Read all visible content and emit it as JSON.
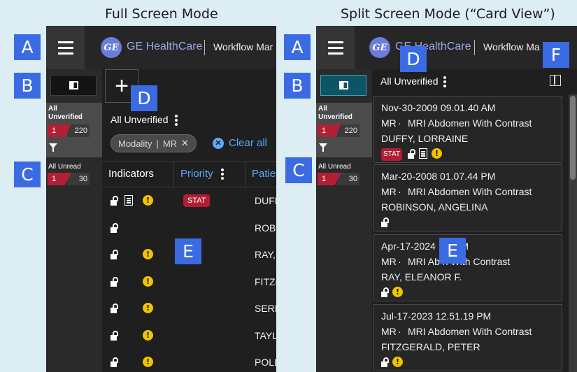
{
  "headings": {
    "full": "Full Screen Mode",
    "split": "Split Screen Mode (“Card View”)"
  },
  "markers": {
    "a": "A",
    "b": "B",
    "c": "C",
    "d": "D",
    "e": "E",
    "f": "F"
  },
  "app": {
    "brand": "GE HealthCare",
    "logo_text": "GE",
    "workflow_full": "Workflow Mar",
    "workflow_split": "Workflow Ma"
  },
  "sidebar": {
    "unverified_label_1": "All",
    "unverified_label_2": "Unverified",
    "unverified_red": "1",
    "unverified_total": "220",
    "unread_label": "All Unread",
    "unread_red": "1",
    "unread_total": "30"
  },
  "full": {
    "plus": "+",
    "list_title": "All Unverified",
    "chip_field": "Modality",
    "chip_sep": "|",
    "chip_value": "MR",
    "chip_close": "✕",
    "clear_all": "Clear all",
    "columns": [
      "Indicators",
      "Priority",
      "Patie"
    ],
    "rows": [
      {
        "patient": "DUFF",
        "stat": "STAT",
        "note": true,
        "warn": true
      },
      {
        "patient": "ROBI",
        "stat": "",
        "note": false,
        "warn": false
      },
      {
        "patient": "RAY,",
        "stat": "",
        "note": false,
        "warn": true
      },
      {
        "patient": "FITZ(",
        "stat": "",
        "note": false,
        "warn": true
      },
      {
        "patient": "SERR",
        "stat": "",
        "note": false,
        "warn": true
      },
      {
        "patient": "TAYL",
        "stat": "",
        "note": false,
        "warn": true
      },
      {
        "patient": "POLL",
        "stat": "",
        "note": false,
        "warn": true
      }
    ]
  },
  "split": {
    "list_title": "All Unverified",
    "cards": [
      {
        "datetime": "Nov-30-2009 09.01.40 AM",
        "modality": "MR",
        "desc": "MRI Abdomen With Contrast",
        "patient": "DUFFY, LORRAINE",
        "stat": "STAT",
        "note": true,
        "warn": true
      },
      {
        "datetime": "Mar-20-2008 01.07.44 PM",
        "modality": "MR",
        "desc": "MRI Abdomen With Contrast",
        "patient": "ROBINSON, ANGELINA",
        "stat": "",
        "note": false,
        "warn": false
      },
      {
        "datetime": "Apr-17-2024 .11 PM",
        "modality": "MR",
        "desc": "MRI Ab n With Contrast",
        "patient": "RAY, ELEANOR F.",
        "stat": "",
        "note": false,
        "warn": true
      },
      {
        "datetime": "Jul-17-2023 12.51.19 PM",
        "modality": "MR",
        "desc": "MRI Abdomen With Contrast",
        "patient": "FITZGERALD, PETER",
        "stat": "",
        "note": false,
        "warn": true
      }
    ]
  },
  "icons": {
    "warn_glyph": "!",
    "dot": "·"
  },
  "colors": {
    "stat_red": "#b31d33",
    "link_blue": "#5fa8ff",
    "marker_blue": "#3a6be2",
    "warning_yellow": "#f2c400",
    "active_teal": "#0d5566"
  }
}
